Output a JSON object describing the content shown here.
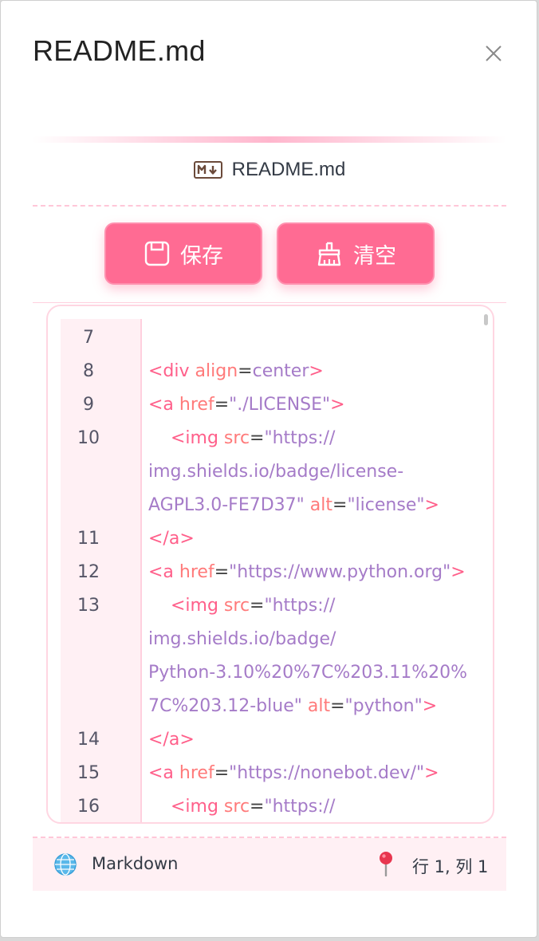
{
  "dialog": {
    "title": "README.md",
    "file_name": "README.md",
    "buttons": {
      "save": "保存",
      "clear": "清空"
    }
  },
  "editor": {
    "lines": [
      {
        "n": "7",
        "tokens": []
      },
      {
        "n": "8",
        "tokens": [
          [
            "tag",
            "<div "
          ],
          [
            "attr",
            "align"
          ],
          [
            "eq",
            "="
          ],
          [
            "str",
            "center"
          ],
          [
            "tag",
            ">"
          ]
        ]
      },
      {
        "n": "9",
        "tokens": [
          [
            "tag",
            "<a "
          ],
          [
            "attr",
            "href"
          ],
          [
            "eq",
            "="
          ],
          [
            "str",
            "\"./LICENSE\""
          ],
          [
            "tag",
            ">"
          ]
        ]
      },
      {
        "n": "10",
        "tokens": [
          [
            "tag",
            "    <img "
          ],
          [
            "attr",
            "src"
          ],
          [
            "eq",
            "="
          ],
          [
            "str",
            "\"https://"
          ]
        ]
      },
      {
        "n": "",
        "tokens": [
          [
            "str",
            "img.shields.io/badge/license-"
          ]
        ]
      },
      {
        "n": "",
        "tokens": [
          [
            "str",
            "AGPL3.0-FE7D37\" "
          ],
          [
            "attr",
            "alt"
          ],
          [
            "eq",
            "="
          ],
          [
            "str",
            "\"license\""
          ],
          [
            "tag",
            ">"
          ]
        ]
      },
      {
        "n": "11",
        "tokens": [
          [
            "tag",
            "</a>"
          ]
        ]
      },
      {
        "n": "12",
        "tokens": [
          [
            "tag",
            "<a "
          ],
          [
            "attr",
            "href"
          ],
          [
            "eq",
            "="
          ],
          [
            "str",
            "\"https://www.python.org\""
          ],
          [
            "tag",
            ">"
          ]
        ]
      },
      {
        "n": "13",
        "tokens": [
          [
            "tag",
            "    <img "
          ],
          [
            "attr",
            "src"
          ],
          [
            "eq",
            "="
          ],
          [
            "str",
            "\"https://"
          ]
        ]
      },
      {
        "n": "",
        "tokens": [
          [
            "str",
            "img.shields.io/badge/"
          ]
        ]
      },
      {
        "n": "",
        "tokens": [
          [
            "str",
            "Python-3.10%20%7C%203.11%20%"
          ]
        ]
      },
      {
        "n": "",
        "tokens": [
          [
            "str",
            "7C%203.12-blue\" "
          ],
          [
            "attr",
            "alt"
          ],
          [
            "eq",
            "="
          ],
          [
            "str",
            "\"python\""
          ],
          [
            "tag",
            ">"
          ]
        ]
      },
      {
        "n": "14",
        "tokens": [
          [
            "tag",
            "</a>"
          ]
        ]
      },
      {
        "n": "15",
        "tokens": [
          [
            "tag",
            "<a "
          ],
          [
            "attr",
            "href"
          ],
          [
            "eq",
            "="
          ],
          [
            "str",
            "\"https://nonebot.dev/\""
          ],
          [
            "tag",
            ">"
          ]
        ]
      },
      {
        "n": "16",
        "tokens": [
          [
            "tag",
            "    <img "
          ],
          [
            "attr",
            "src"
          ],
          [
            "eq",
            "="
          ],
          [
            "str",
            "\"https://"
          ]
        ]
      }
    ]
  },
  "status": {
    "language": "Markdown",
    "position": "行 1, 列 1"
  },
  "colors": {
    "accent": "#ff6b93",
    "tag": "#ff5f8a",
    "attr": "#ff7a7a",
    "string": "#a57bc8"
  }
}
